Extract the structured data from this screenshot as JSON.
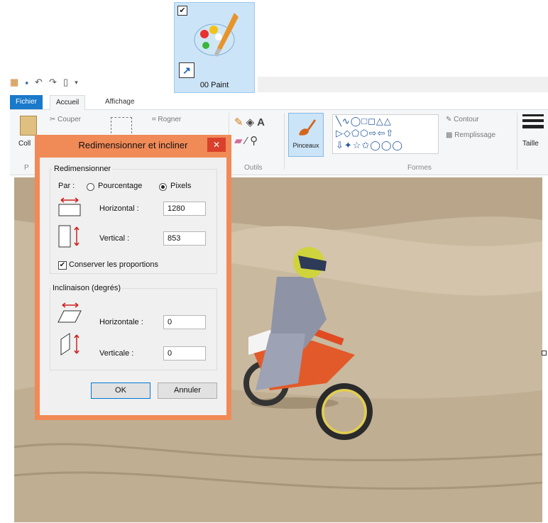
{
  "shortcut": {
    "label": "00 Paint",
    "checkbox": "✔",
    "arrow": "↗"
  },
  "quick_access": {
    "icons": [
      "paint-icon",
      "save-icon",
      "undo-icon",
      "redo-icon",
      "new-icon",
      "dropdown-icon"
    ]
  },
  "tabs": [
    {
      "label": "Fichier"
    },
    {
      "label": "Accueil"
    },
    {
      "label": "Affichage"
    }
  ],
  "ribbon": {
    "clipboard": {
      "paste": "Coll",
      "cut": "Couper",
      "group": "P"
    },
    "image": {
      "crop": "Rogner"
    },
    "tools": {
      "group": "Outils"
    },
    "brushes": {
      "label": "Pinceaux"
    },
    "shapes": {
      "row1": "╲∿◯□◻△△",
      "row2": "▷◇⬠⬡⇨⇦⇧",
      "row3": "⇩✦☆✩◯◯◯",
      "group": "Formes",
      "outline": "Contour",
      "fill": "Remplissage"
    },
    "size": {
      "label": "Taille"
    }
  },
  "dialog": {
    "title": "Redimensionner et incliner",
    "close": "✕",
    "resize": {
      "title": "Redimensionner",
      "by_label": "Par :",
      "percent_label": "Pourcentage",
      "pixels_label": "Pixels",
      "selected": "Pixels",
      "horizontal_label": "Horizontal :",
      "horizontal_value": "1280",
      "vertical_label": "Vertical :",
      "vertical_value": "853",
      "keep_ratio_label": "Conserver les proportions",
      "keep_ratio_checked": true
    },
    "skew": {
      "title": "Inclinaison (degrés)",
      "horizontal_label": "Horizontale :",
      "horizontal_value": "0",
      "vertical_label": "Verticale :",
      "vertical_value": "0"
    },
    "ok": "OK",
    "cancel": "Annuler"
  },
  "colors": {
    "accent": "#1979ca",
    "dialog_border": "#f08a57",
    "close": "#d9412c",
    "ribbon_bg": "#f5f6f7"
  }
}
